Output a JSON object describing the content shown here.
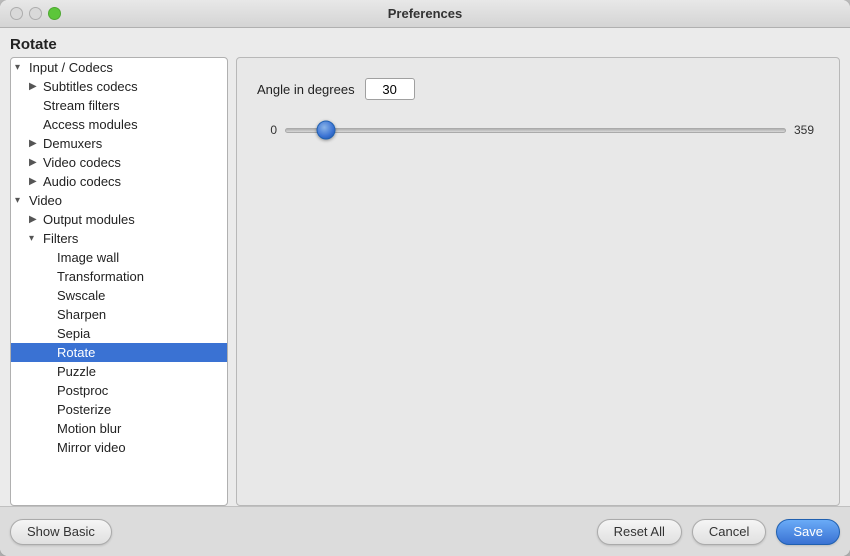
{
  "window": {
    "title": "Preferences",
    "page_heading": "Rotate"
  },
  "traffic_lights": {
    "close_label": "close",
    "minimize_label": "minimize",
    "maximize_label": "maximize"
  },
  "sidebar": {
    "items": [
      {
        "id": "input-codecs",
        "label": "Input / Codecs",
        "indent": 0,
        "arrow": "▾",
        "selected": false
      },
      {
        "id": "subtitles-codecs",
        "label": "Subtitles codecs",
        "indent": 1,
        "arrow": "▶",
        "selected": false
      },
      {
        "id": "stream-filters",
        "label": "Stream filters",
        "indent": 1,
        "arrow": "",
        "selected": false
      },
      {
        "id": "access-modules",
        "label": "Access modules",
        "indent": 1,
        "arrow": "",
        "selected": false
      },
      {
        "id": "demuxers",
        "label": "Demuxers",
        "indent": 1,
        "arrow": "▶",
        "selected": false
      },
      {
        "id": "video-codecs",
        "label": "Video codecs",
        "indent": 1,
        "arrow": "▶",
        "selected": false
      },
      {
        "id": "audio-codecs",
        "label": "Audio codecs",
        "indent": 1,
        "arrow": "▶",
        "selected": false
      },
      {
        "id": "video",
        "label": "Video",
        "indent": 0,
        "arrow": "▾",
        "selected": false
      },
      {
        "id": "output-modules",
        "label": "Output modules",
        "indent": 1,
        "arrow": "▶",
        "selected": false
      },
      {
        "id": "filters",
        "label": "Filters",
        "indent": 1,
        "arrow": "▾",
        "selected": false
      },
      {
        "id": "image-wall",
        "label": "Image wall",
        "indent": 2,
        "arrow": "",
        "selected": false
      },
      {
        "id": "transformation",
        "label": "Transformation",
        "indent": 2,
        "arrow": "",
        "selected": false
      },
      {
        "id": "swscale",
        "label": "Swscale",
        "indent": 2,
        "arrow": "",
        "selected": false
      },
      {
        "id": "sharpen",
        "label": "Sharpen",
        "indent": 2,
        "arrow": "",
        "selected": false
      },
      {
        "id": "sepia",
        "label": "Sepia",
        "indent": 2,
        "arrow": "",
        "selected": false
      },
      {
        "id": "rotate",
        "label": "Rotate",
        "indent": 2,
        "arrow": "",
        "selected": true
      },
      {
        "id": "puzzle",
        "label": "Puzzle",
        "indent": 2,
        "arrow": "",
        "selected": false
      },
      {
        "id": "postproc",
        "label": "Postproc",
        "indent": 2,
        "arrow": "",
        "selected": false
      },
      {
        "id": "posterize",
        "label": "Posterize",
        "indent": 2,
        "arrow": "",
        "selected": false
      },
      {
        "id": "motion-blur",
        "label": "Motion blur",
        "indent": 2,
        "arrow": "",
        "selected": false
      },
      {
        "id": "mirror-video",
        "label": "Mirror video",
        "indent": 2,
        "arrow": "",
        "selected": false
      }
    ]
  },
  "right_panel": {
    "angle_label": "Angle in degrees",
    "angle_value": "30",
    "slider_min": "0",
    "slider_max": "359",
    "slider_value": 30,
    "slider_percent": 8
  },
  "bottom": {
    "show_basic_label": "Show Basic",
    "reset_all_label": "Reset All",
    "cancel_label": "Cancel",
    "save_label": "Save"
  }
}
